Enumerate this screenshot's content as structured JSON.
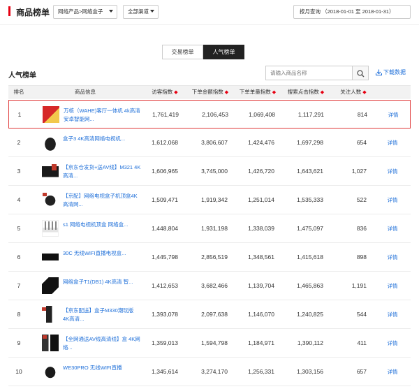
{
  "header": {
    "title": "商品榜单",
    "category_select": "网络产品>网络盒子",
    "channel_select": "全部渠道",
    "date_range": "按月查询 （2018-01-01 至 2018-01-31）"
  },
  "tabs": [
    {
      "label": "交易榜单",
      "active": false
    },
    {
      "label": "人气榜单",
      "active": true
    }
  ],
  "section": {
    "title": "人气榜单",
    "search_placeholder": "请输入商品名称",
    "download_label": "下载数据"
  },
  "table": {
    "columns": [
      "排名",
      "商品信息",
      "访客指数",
      "下单金额指数",
      "下单单量指数",
      "搜索点击指数",
      "关注人数"
    ],
    "sortable_mark": "◆",
    "detail_label": "详情",
    "rows": [
      {
        "rank": "1",
        "name": "万核（WAHE)客厅一体机 4k高清安卓智能网...",
        "visits": "1,761,419",
        "amount": "2,106,453",
        "qty": "1,069,408",
        "clicks": "1,117,291",
        "follows": "814",
        "thumb": "a"
      },
      {
        "rank": "2",
        "name": "盒子3 4K高清网络电视机...",
        "visits": "1,612,068",
        "amount": "3,806,607",
        "qty": "1,424,476",
        "clicks": "1,697,298",
        "follows": "654",
        "thumb": "b"
      },
      {
        "rank": "3",
        "name": "【京东仓发货+送AV线】M321 4K高清...",
        "visits": "1,606,965",
        "amount": "3,745,000",
        "qty": "1,426,720",
        "clicks": "1,643,621",
        "follows": "1,027",
        "thumb": "c"
      },
      {
        "rank": "4",
        "name": "【京配】网络电视盒子机顶盒4K高清网...",
        "visits": "1,509,471",
        "amount": "1,919,342",
        "qty": "1,251,014",
        "clicks": "1,535,333",
        "follows": "522",
        "thumb": "d"
      },
      {
        "rank": "5",
        "name": "s1 网络电视机顶盒 网络盒...",
        "visits": "1,448,804",
        "amount": "1,931,198",
        "qty": "1,338,039",
        "clicks": "1,475,097",
        "follows": "836",
        "thumb": "e"
      },
      {
        "rank": "6",
        "name": "30C 无线WIFI直播电视盒...",
        "visits": "1,445,798",
        "amount": "2,856,519",
        "qty": "1,348,561",
        "clicks": "1,415,618",
        "follows": "898",
        "thumb": "f"
      },
      {
        "rank": "7",
        "name": "网络盒子T1(DB1) 4K高清 智...",
        "visits": "1,412,653",
        "amount": "3,682,466",
        "qty": "1,139,704",
        "clicks": "1,465,863",
        "follows": "1,191",
        "thumb": "g"
      },
      {
        "rank": "8",
        "name": "【京东配送】盒子M330潮玩版 4K高清...",
        "visits": "1,393,078",
        "amount": "2,097,638",
        "qty": "1,146,070",
        "clicks": "1,240,825",
        "follows": "544",
        "thumb": "h"
      },
      {
        "rank": "9",
        "name": "【全网通送AV线高清线】盒 4K网络...",
        "visits": "1,359,013",
        "amount": "1,594,798",
        "qty": "1,184,971",
        "clicks": "1,390,112",
        "follows": "411",
        "thumb": "i"
      },
      {
        "rank": "10",
        "name": "WE30PRO 无线WIFI直播",
        "visits": "1,345,614",
        "amount": "3,274,170",
        "qty": "1,256,331",
        "clicks": "1,303,156",
        "follows": "657",
        "thumb": "j"
      }
    ]
  },
  "colors": {
    "accent": "#e60012",
    "link": "#1e6fd9",
    "highlight_border": "#e03b3b"
  }
}
